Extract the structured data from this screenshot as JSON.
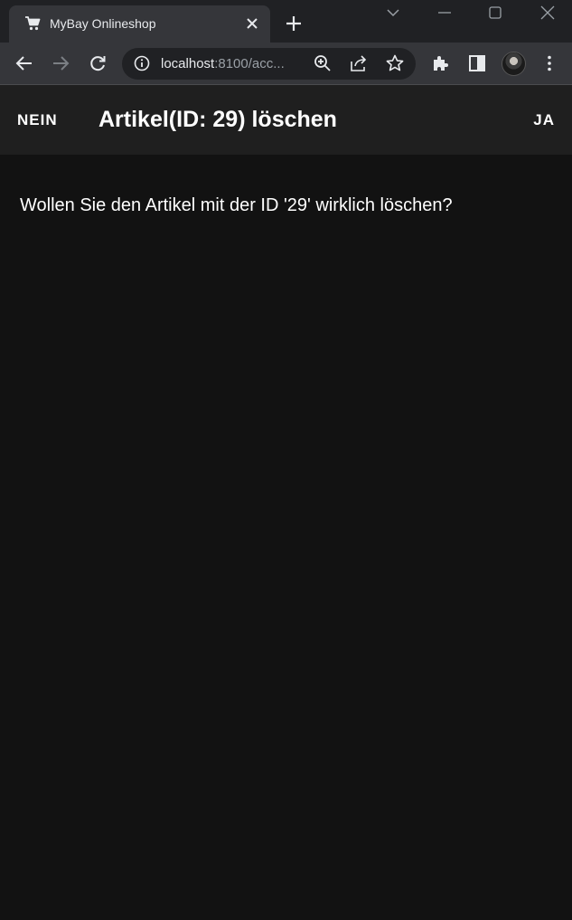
{
  "browser": {
    "tab_title": "MyBay Onlineshop",
    "url_host": "localhost",
    "url_rest": ":8100/acc..."
  },
  "header": {
    "cancel_label": "NEIN",
    "title": "Artikel(ID: 29) löschen",
    "confirm_label": "JA"
  },
  "content": {
    "message": "Wollen Sie den Artikel mit der ID '29' wirklich löschen?"
  },
  "colors": {
    "background": "#121212",
    "header": "#1f1f1f",
    "text": "#ffffff"
  }
}
